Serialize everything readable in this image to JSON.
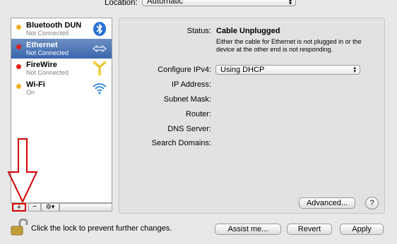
{
  "location": {
    "label": "Location:",
    "value": "Automatic"
  },
  "sidebar": {
    "services": [
      {
        "name": "Bluetooth DUN",
        "status": "Not Connected",
        "dot_color": "#f0b21e",
        "icon": "bluetooth-icon",
        "selected": false
      },
      {
        "name": "Ethernet",
        "status": "Not Connected",
        "dot_color": "#e0211b",
        "icon": "ethernet-arrows-icon",
        "selected": true
      },
      {
        "name": "FireWire",
        "status": "Not Connected",
        "dot_color": "#e0211b",
        "icon": "firewire-icon",
        "selected": false
      },
      {
        "name": "Wi-Fi",
        "status": "On",
        "dot_color": "#f0b21e",
        "icon": "wifi-icon",
        "selected": false
      }
    ],
    "controls": {
      "add": "+",
      "remove": "−",
      "gear": "⚙▾"
    }
  },
  "detail": {
    "status_label": "Status:",
    "status_value": "Cable Unplugged",
    "status_description": "Either the cable for Ethernet is not plugged in or the device at the other end is not responding.",
    "configure_label": "Configure IPv4:",
    "configure_value": "Using DHCP",
    "ip_label": "IP Address:",
    "subnet_label": "Subnet Mask:",
    "router_label": "Router:",
    "dns_label": "DNS Server:",
    "search_label": "Search Domains:",
    "advanced_button": "Advanced...",
    "help_button": "?"
  },
  "footer": {
    "lock_text": "Click the lock to prevent further changes.",
    "assist_button": "Assist me...",
    "revert_button": "Revert",
    "apply_button": "Apply"
  },
  "annotation_color": "#d40000"
}
